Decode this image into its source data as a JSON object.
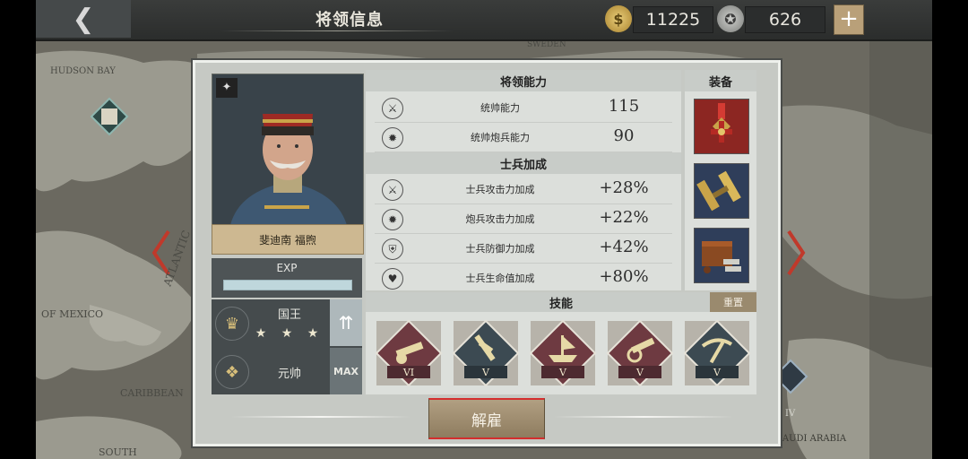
{
  "header": {
    "back_icon": "chevron-left-icon",
    "title": "将领信息",
    "currency_gold": "11225",
    "currency_medal": "626",
    "plus_icon": "plus-icon"
  },
  "map": {
    "labels": [
      "HUDSON BAY",
      "OF MEXICO",
      "CARIBBEAN",
      "ATLANTIC",
      "SOUTH",
      "SWEDEN",
      "SAUDI ARABIA"
    ],
    "unit_badge_left_icon": "scroll-icon",
    "unit_badge_right_level": "IV"
  },
  "general": {
    "name": "斐迪南 福煦",
    "branch_icon": "cannon-icon",
    "exp_label": "EXP",
    "exp_fraction": 1.0,
    "rank_title": "国王",
    "rank_stars": "★ ★ ★",
    "military_rank": "元帅",
    "max_label": "MAX",
    "upgrade_icon": "double-up-arrow-icon"
  },
  "abilities": {
    "header": "将领能力",
    "rows": [
      {
        "icon": "crossed-swords-icon",
        "label": "统帅能力",
        "value": "115"
      },
      {
        "icon": "cannon-icon",
        "label": "统帅炮兵能力",
        "value": "90"
      }
    ]
  },
  "bonuses": {
    "header": "士兵加成",
    "rows": [
      {
        "icon": "sword-attack-icon",
        "label": "士兵攻击力加成",
        "value": "+28%"
      },
      {
        "icon": "cannon-attack-icon",
        "label": "炮兵攻击力加成",
        "value": "+22%"
      },
      {
        "icon": "shield-icon",
        "label": "士兵防御力加成",
        "value": "+42%"
      },
      {
        "icon": "heart-icon",
        "label": "士兵生命值加成",
        "value": "+80%"
      }
    ]
  },
  "equipment": {
    "header": "装备",
    "items": [
      {
        "icon": "medal-cross-icon"
      },
      {
        "icon": "binoculars-icon"
      },
      {
        "icon": "ammo-box-icon"
      }
    ]
  },
  "skills": {
    "header": "技能",
    "reset_label": "重置",
    "items": [
      {
        "icon": "cannon-skill-icon",
        "level": "VI",
        "color": "#6e3a41"
      },
      {
        "icon": "bayonet-skill-icon",
        "level": "V",
        "color": "#3c4a52"
      },
      {
        "icon": "ship-skill-icon",
        "level": "V",
        "color": "#6e3a41"
      },
      {
        "icon": "artillery-skill-icon",
        "level": "V",
        "color": "#6e3a41"
      },
      {
        "icon": "pickaxe-skill-icon",
        "level": "V",
        "color": "#3c4a52"
      }
    ]
  },
  "dismiss_label": "解雇",
  "colors": {
    "accent_gold": "#cdb891",
    "skill_red": "#6e3a41",
    "skill_slate": "#3c4a52",
    "dismiss_border": "#d42e2e"
  }
}
